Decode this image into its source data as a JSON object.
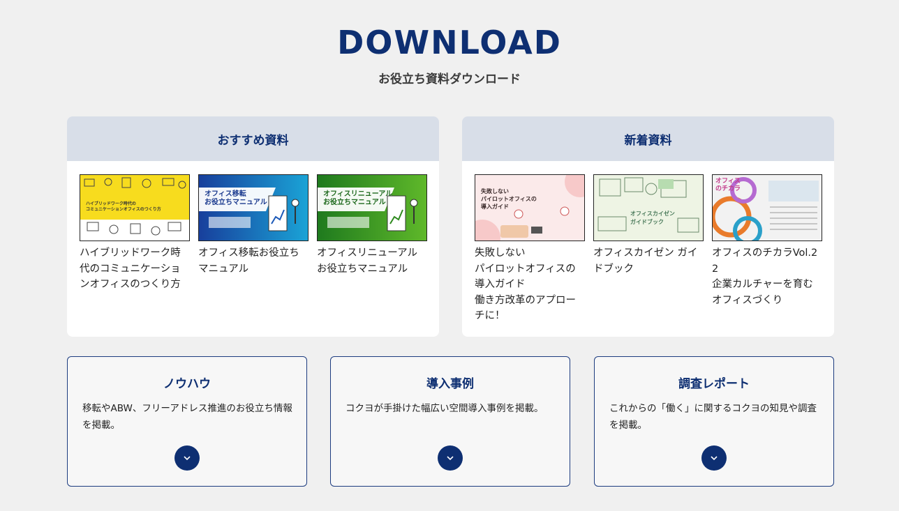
{
  "hero": {
    "title": "DOWNLOAD",
    "subtitle": "お役立ち資料ダウンロード"
  },
  "recommended": {
    "heading": "おすすめ資料",
    "items": [
      {
        "title": "ハイブリッドワーク時代のコミュニケーションオフィスのつくり方",
        "thumb_text": [
          "ハイブリッドワーク時代の",
          "コミュニケーションオフィスのつくり方"
        ],
        "thumb_color": "#f7dc1e"
      },
      {
        "title": "オフィス移転お役立ちマニュアル",
        "thumb_text": [
          "オフィス移転",
          "お役立ちマニュアル"
        ],
        "thumb_color": "#1c59b8"
      },
      {
        "title": "オフィスリニューアルお役立ちマニュアル",
        "thumb_text": [
          "オフィスリニューアル",
          "お役立ちマニュアル"
        ],
        "thumb_color": "#2e8a1e"
      }
    ]
  },
  "new_arrivals": {
    "heading": "新着資料",
    "items": [
      {
        "title": "失敗しない\nパイロットオフィスの導入ガイド\n働き方改革のアプローチに！",
        "thumb_text": [
          "失敗しない",
          "パイロットオフィスの",
          "導入ガイド"
        ],
        "thumb_color": "#fbeaea"
      },
      {
        "title": "オフィスカイゼン ガイドブック",
        "thumb_text": [
          "オフィスカイゼン",
          "ガイドブック"
        ],
        "thumb_color": "#eef4e4"
      },
      {
        "title": "オフィスのチカラVol.22\n企業カルチャーを育むオフィスづくり",
        "thumb_text": [
          "オフィス",
          "のチカラ"
        ],
        "thumb_color": "#f2f2f2"
      }
    ]
  },
  "cards": [
    {
      "title": "ノウハウ",
      "description": "移転やABW、フリーアドレス推進のお役立ち情報を掲載。",
      "icon": "chevron-down-icon"
    },
    {
      "title": "導入事例",
      "description": "コクヨが手掛けた幅広い空間導入事例を掲載。",
      "icon": "chevron-down-icon"
    },
    {
      "title": "調査レポート",
      "description": "これからの「働く」に関するコクヨの知見や調査を掲載。",
      "icon": "chevron-down-icon"
    }
  ],
  "colors": {
    "brand_navy": "#0e2f72",
    "panel_header": "#d8dee8",
    "background": "#f0f0f0"
  }
}
